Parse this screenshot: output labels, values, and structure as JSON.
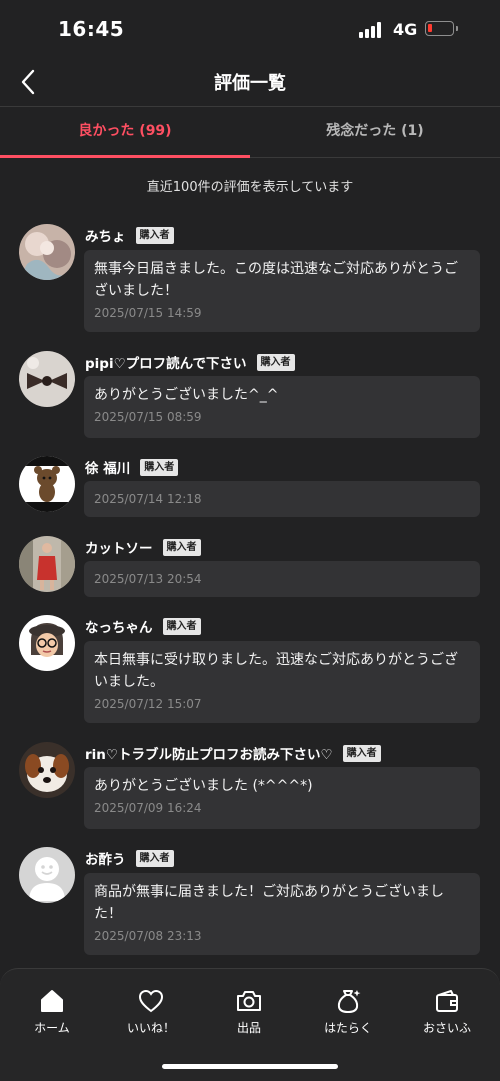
{
  "status_bar": {
    "time": "16:45",
    "network": "4G"
  },
  "header": {
    "title": "評価一覧",
    "back_icon": "chevron-left-icon"
  },
  "tabs": [
    {
      "label": "良かった (99)",
      "active": true
    },
    {
      "label": "残念だった (1)",
      "active": false
    }
  ],
  "notice": "直近100件の評価を表示しています",
  "reviews": [
    {
      "name": "みちょ",
      "badge": "購入者",
      "comment": "無事今日届きました。この度は迅速なご対応ありがとうございました！",
      "date": "2025/07/15 14:59"
    },
    {
      "name": "pipi♡プロフ読んで下さい",
      "badge": "購入者",
      "comment": "ありがとうございました^_^",
      "date": "2025/07/15 08:59"
    },
    {
      "name": "徐 福川",
      "badge": "購入者",
      "comment": "",
      "date": "2025/07/14 12:18"
    },
    {
      "name": "カットソー",
      "badge": "購入者",
      "comment": "",
      "date": "2025/07/13 20:54"
    },
    {
      "name": "なっちゃん",
      "badge": "購入者",
      "comment": "本日無事に受け取りました。迅速なご対応ありがとうございました。",
      "date": "2025/07/12 15:07"
    },
    {
      "name": "rin♡トラブル防止プロフお読み下さい♡",
      "badge": "購入者",
      "comment": "ありがとうございました (*^^^*)",
      "date": "2025/07/09 16:24"
    },
    {
      "name": "お酢う",
      "badge": "購入者",
      "comment": "商品が無事に届きました！ご対応ありがとうございました！",
      "date": "2025/07/08 23:13"
    }
  ],
  "bottom_nav": [
    {
      "label": "ホーム",
      "icon": "home-icon"
    },
    {
      "label": "いいね！",
      "icon": "heart-icon"
    },
    {
      "label": "出品",
      "icon": "camera-icon"
    },
    {
      "label": "はたらく",
      "icon": "money-bag-icon"
    },
    {
      "label": "おさいふ",
      "icon": "wallet-icon"
    }
  ],
  "colors": {
    "accent": "#ff4f62",
    "background": "#222223",
    "bubble": "#333335",
    "battery_low": "#ff3b30"
  }
}
